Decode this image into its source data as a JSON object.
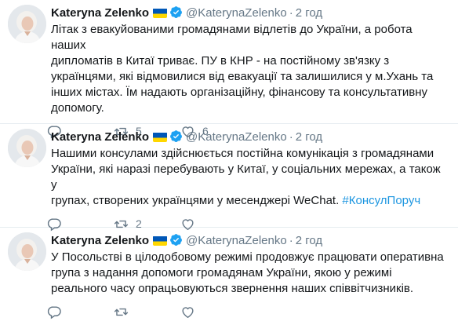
{
  "author": {
    "name": "Kateryna Zelenko",
    "handle": "@KaterynaZelenko",
    "separator": "·"
  },
  "colors": {
    "flag_blue": "#0057b7",
    "flag_yellow": "#ffd700",
    "verified": "#1da1f2",
    "hashtag": "#1b95e0",
    "muted": "#657786"
  },
  "icons": [
    "reply-icon",
    "retweet-icon",
    "like-icon",
    "verified-badge-icon",
    "ukraine-flag-icon"
  ],
  "tweets": [
    {
      "time": "2 год",
      "text": "Літак з евакуйованими громадянами відлетів до України, а робота наших\nдипломатів в Китаї триває. ПУ в КНР - на постійному зв'язку з\nукраїнцями, які відмовилися від евакуації та залишилися у м.Ухань та\nінших містах. Їм надають організаційну, фінансову та консультативну\nдопомогу.",
      "hashtag": "",
      "reply_count": "",
      "retweet_count": "5",
      "like_count": "6"
    },
    {
      "time": "2 год",
      "text": "Нашими консулами здійснюється постійна комунікація з громадянами\nУкраїни, які наразі перебувають у Китаї, у соціальних мережах, а також у\nгрупах, створених українцями у месенджері WeChat. ",
      "hashtag": "#КонсулПоруч",
      "reply_count": "",
      "retweet_count": "2",
      "like_count": ""
    },
    {
      "time": "2 год",
      "text": "У Посольстві в цілодобовому режимі продовжує працювати оперативна\nгрупа з надання допомоги громадянам України, якою у режимі\nреального часу опрацьовуються звернення наших співвітчизників.",
      "hashtag": "",
      "reply_count": "",
      "retweet_count": "",
      "like_count": ""
    }
  ]
}
